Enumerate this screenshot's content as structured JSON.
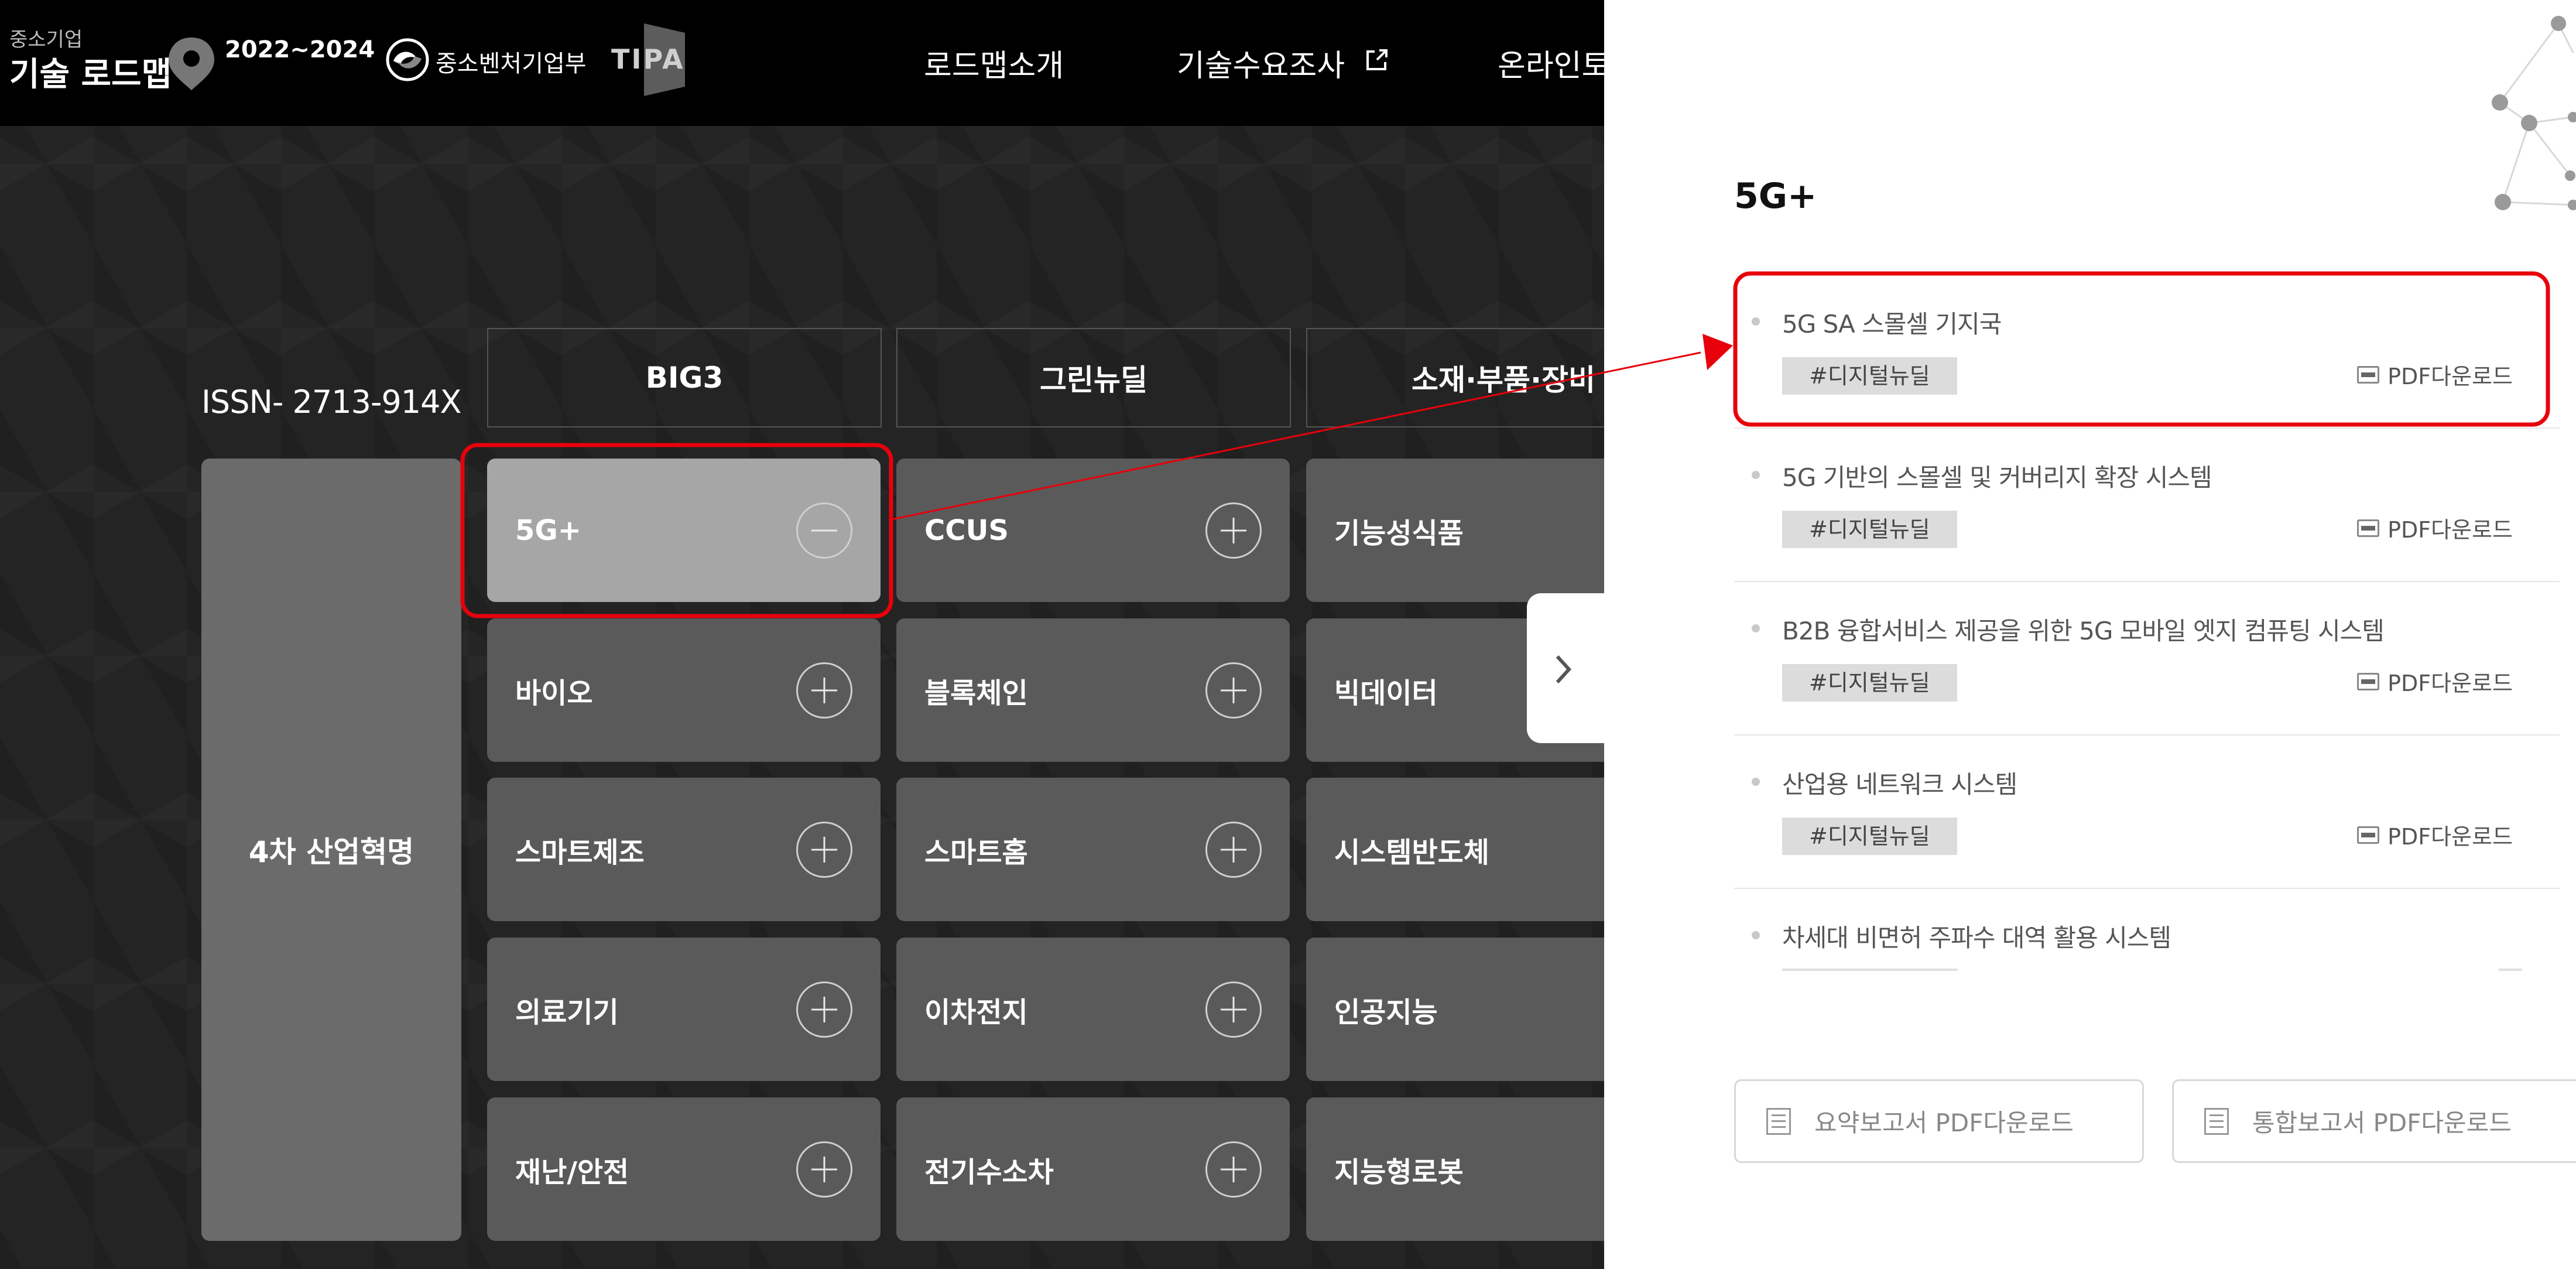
{
  "header": {
    "brand_small": "중소기업",
    "brand_main": "기술 로드맵",
    "years": "2022~2024",
    "ministry": "중소벤처기업부",
    "org": "TIPA",
    "nav": [
      "로드맵소개",
      "기술수요조사",
      "온라인토"
    ]
  },
  "issn": "ISSN- 2713-914X",
  "category_tabs": [
    "BIG3",
    "그린뉴딜",
    "소재·부품·장비"
  ],
  "row_header": "4차 산업혁명",
  "grid": {
    "col1": [
      "5G+",
      "바이오",
      "스마트제조",
      "의료기기",
      "재난/안전"
    ],
    "col2": [
      "CCUS",
      "블록체인",
      "스마트홈",
      "이차전지",
      "전기수소차"
    ],
    "col3": [
      "기능성식품",
      "빅데이터",
      "시스템반도체",
      "인공지능",
      "지능형로봇"
    ]
  },
  "panel": {
    "title": "5G+",
    "items": [
      {
        "title": "5G SA 스몰셀 기지국",
        "tag": "#디지털뉴딜",
        "pdf": "PDF다운로드"
      },
      {
        "title": "5G 기반의 스몰셀 및 커버리지 확장 시스템",
        "tag": "#디지털뉴딜",
        "pdf": "PDF다운로드"
      },
      {
        "title": "B2B 융합서비스 제공을 위한 5G 모바일 엣지 컴퓨팅 시스템",
        "tag": "#디지털뉴딜",
        "pdf": "PDF다운로드"
      },
      {
        "title": "산업용 네트워크 시스템",
        "tag": "#디지털뉴딜",
        "pdf": "PDF다운로드"
      },
      {
        "title": "차세대 비면허 주파수 대역 활용 시스템",
        "tag": "",
        "pdf": ""
      }
    ],
    "summary_button": "요약보고서 PDF다운로드",
    "integrated_button": "통합보고서 PDF다운로드"
  },
  "colors": {
    "highlight": "#e8000b",
    "header_bg": "#000000",
    "cell": "#5a5a5a",
    "active_cell": "#a6a6a6"
  }
}
